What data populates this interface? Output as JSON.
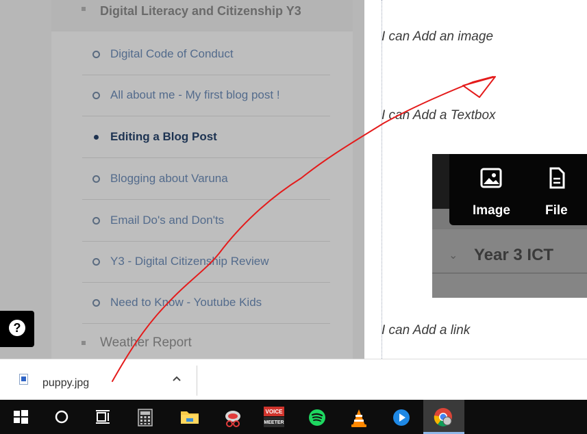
{
  "nav": {
    "section_title": "Digital Literacy and Citizenship Y3",
    "items": [
      {
        "label": "Digital Code of Conduct",
        "active": false
      },
      {
        "label": "All about me - My first blog post !",
        "active": false
      },
      {
        "label": "Editing a Blog Post",
        "active": true
      },
      {
        "label": "Blogging about Varuna",
        "active": false
      },
      {
        "label": "Email Do's and Don'ts",
        "active": false
      },
      {
        "label": "Y3 - Digital Citizenship Review",
        "active": false
      },
      {
        "label": "Need to Know - Youtube Kids",
        "active": false
      }
    ],
    "next_section_title": "Weather Report"
  },
  "help": {
    "symbol": "?"
  },
  "content": {
    "lines": [
      "I can Add an image",
      "I can Add a Textbox",
      "I can Add a link"
    ],
    "embedded": {
      "menu_items": [
        {
          "label": "Image",
          "icon": "image-icon"
        },
        {
          "label": "File",
          "icon": "file-icon"
        }
      ],
      "course_title": "Year 3 ICT"
    }
  },
  "download_bar": {
    "filename": "puppy.jpg"
  },
  "taskbar": {
    "items": [
      "windows-start-icon",
      "cortana-icon",
      "task-view-icon",
      "calculator-icon",
      "file-explorer-icon",
      "snipping-tool-icon",
      "voicemeeter-icon",
      "spotify-icon",
      "vlc-icon",
      "media-player-icon",
      "chrome-icon"
    ],
    "voicemeeter_text": [
      "VOICE",
      "MEETER"
    ]
  },
  "colors": {
    "annotation": "#e41b1b",
    "nav_link": "#536b8c",
    "nav_active": "#1d3352",
    "taskbar": "#0d0d0d"
  }
}
